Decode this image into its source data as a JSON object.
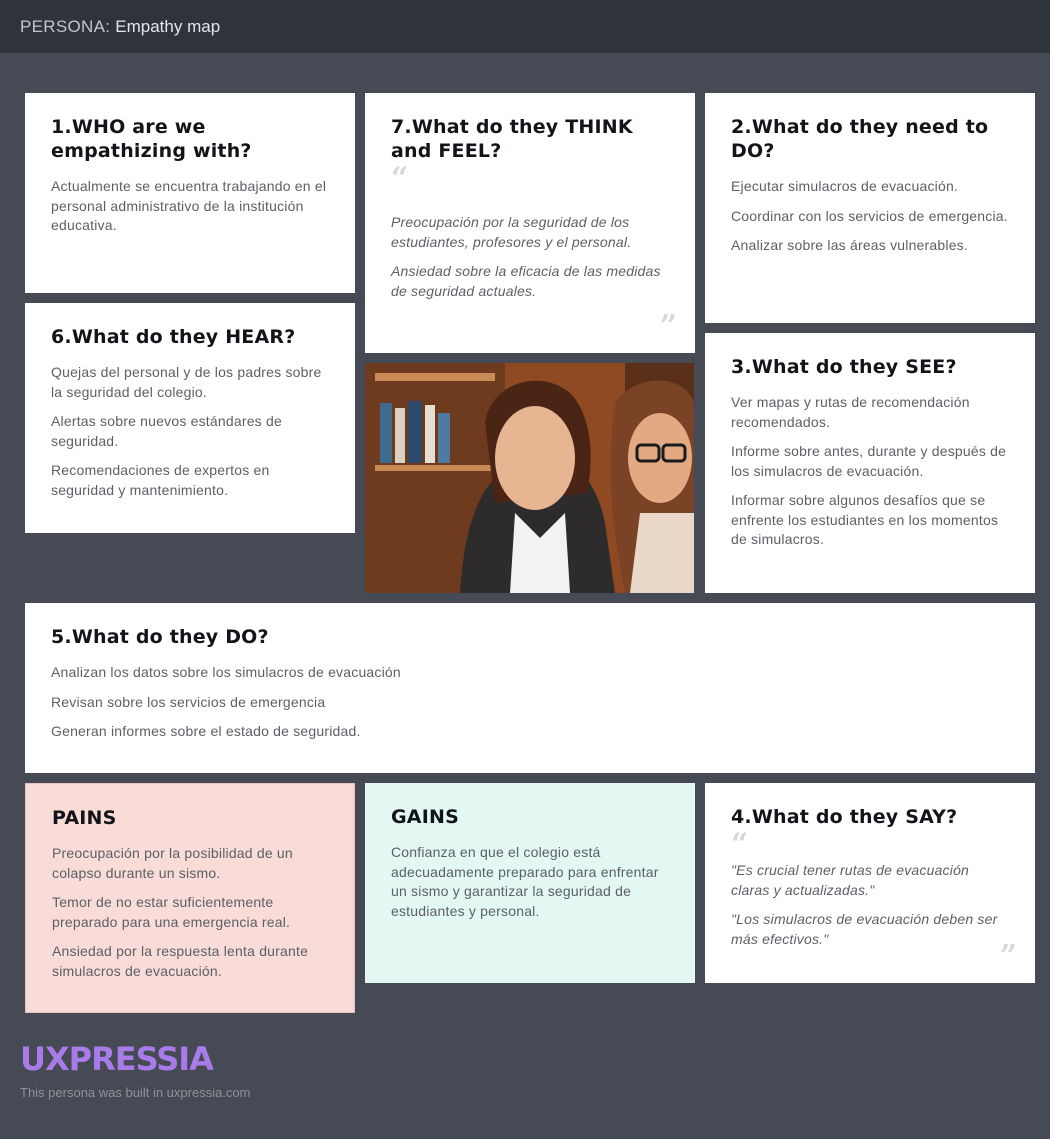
{
  "header": {
    "prefix": "PERSONA:",
    "title": "Empathy map"
  },
  "who": {
    "title": "1.WHO are we empathizing with?",
    "items": [
      "Actualmente se encuentra trabajando en el personal administrativo de la institución educativa."
    ]
  },
  "think": {
    "title": "7.What do they THINK and FEEL?",
    "items": [
      "Preocupación por la seguridad de los estudiantes, profesores y el personal.",
      "Ansiedad sobre la eficacia de las medidas de seguridad actuales."
    ]
  },
  "need": {
    "title": "2.What do they need to DO?",
    "items": [
      "Ejecutar simulacros de evacuación.",
      "Coordinar con los servicios de emergencia.",
      "Analizar sobre las áreas vulnerables."
    ]
  },
  "hear": {
    "title": "6.What do they HEAR?",
    "items": [
      "Quejas del personal y de los padres sobre la seguridad del colegio.",
      "Alertas sobre nuevos estándares de seguridad.",
      "Recomendaciones de expertos en seguridad y mantenimiento."
    ]
  },
  "see": {
    "title": "3.What do they SEE?",
    "items": [
      "Ver mapas y rutas de recomendación recomendados.",
      "Informe sobre antes, durante y después de los simulacros de evacuación.",
      "Informar sobre algunos desafíos que se enfrente los estudiantes en los momentos de simulacros."
    ]
  },
  "do": {
    "title": "5.What do they DO?",
    "items": [
      "Analizan los datos sobre los simulacros de evacuación",
      "Revisan sobre los servicios de emergencia",
      "Generan informes sobre el estado de seguridad."
    ]
  },
  "pains": {
    "title": "PAINS",
    "items": [
      "Preocupación por la posibilidad de un colapso durante un sismo.",
      "Temor de no estar suficientemente preparado para una emergencia real.",
      "Ansiedad por la respuesta lenta durante simulacros de evacuación."
    ]
  },
  "gains": {
    "title": "GAINS",
    "items": [
      "Confianza en que el colegio está adecuadamente preparado para enfrentar un sismo y garantizar la seguridad de estudiantes y personal."
    ]
  },
  "say": {
    "title": "4.What do they SAY?",
    "items": [
      "\"Es crucial tener rutas de evacuación claras y actualizadas.\"",
      " \"Los simulacros de evacuación deben ser más efectivos.\""
    ]
  },
  "quote_marks": {
    "open": "“",
    "close": "”"
  },
  "footer": {
    "brand": "UXPRESSIA",
    "credit": "This persona was built in uxpressia.com"
  },
  "colors": {
    "background": "#454a54",
    "topbar": "#2f333c",
    "pains": "#f9dbd7",
    "gains": "#e3f7f3",
    "brand": "#a97be8"
  }
}
